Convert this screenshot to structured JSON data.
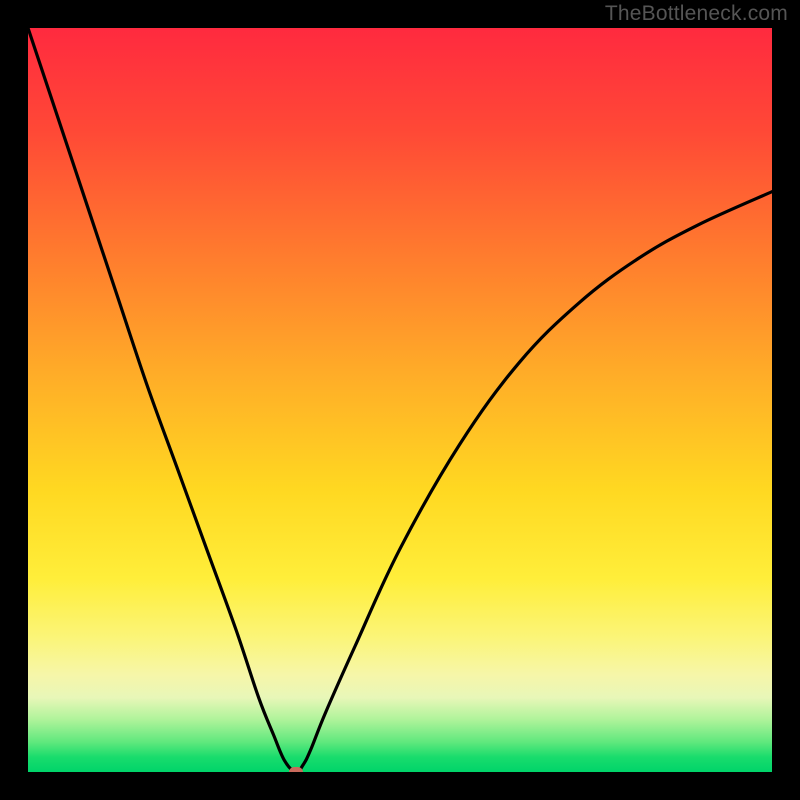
{
  "watermark": "TheBottleneck.com",
  "chart_data": {
    "type": "line",
    "title": "",
    "xlabel": "",
    "ylabel": "",
    "xlim": [
      0,
      100
    ],
    "ylim": [
      0,
      100
    ],
    "grid": false,
    "legend": false,
    "background": {
      "kind": "vertical-gradient",
      "stops": [
        {
          "pos": 0,
          "color": "#ff2a3f"
        },
        {
          "pos": 30,
          "color": "#ff7a2e"
        },
        {
          "pos": 62,
          "color": "#ffd821"
        },
        {
          "pos": 87,
          "color": "#f6f6a9"
        },
        {
          "pos": 100,
          "color": "#00d46a"
        }
      ]
    },
    "series": [
      {
        "name": "bottleneck-curve",
        "color": "#000000",
        "x": [
          0,
          4,
          8,
          12,
          16,
          20,
          24,
          28,
          31,
          33,
          34.5,
          36,
          37,
          38,
          40,
          44,
          50,
          58,
          66,
          74,
          82,
          90,
          100
        ],
        "y": [
          100,
          88,
          76,
          64,
          52,
          41,
          30,
          19,
          10,
          5,
          1.5,
          0,
          1,
          3,
          8,
          17,
          30,
          44,
          55,
          63,
          69,
          73.5,
          78
        ]
      }
    ],
    "marker": {
      "x": 36,
      "y": 0,
      "color": "#c96a5c",
      "shape": "rounded-rect"
    }
  }
}
